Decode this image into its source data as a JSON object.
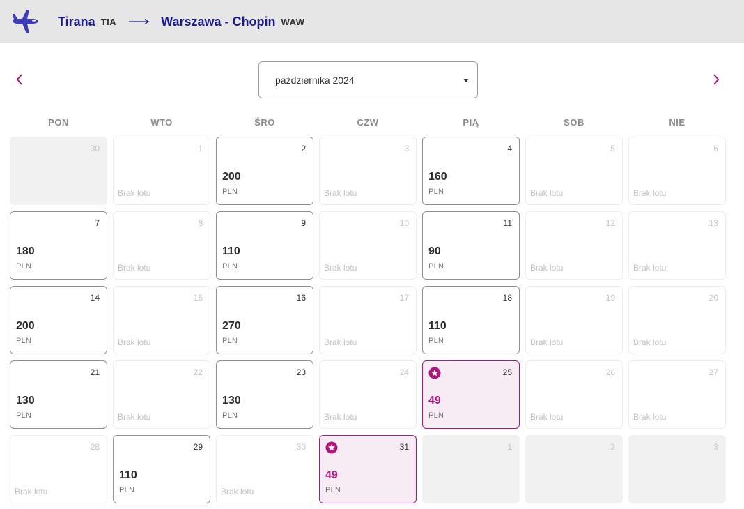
{
  "header": {
    "origin_city": "Tirana",
    "origin_code": "TIA",
    "destination_city": "Warszawa - Chopin",
    "destination_code": "WAW"
  },
  "month_select": {
    "value": "października 2024"
  },
  "weekdays": [
    "PON",
    "WTO",
    "ŚRO",
    "CZW",
    "PIĄ",
    "SOB",
    "NIE"
  ],
  "no_flight_label": "Brak lotu",
  "colors": {
    "brand": "#b0177e",
    "header_bg": "#e6e6e6",
    "plane": "#3b3bb8"
  },
  "days": [
    {
      "day": "30",
      "state": "outside"
    },
    {
      "day": "1",
      "state": "none"
    },
    {
      "day": "2",
      "state": "price",
      "amount": "200",
      "currency": "PLN"
    },
    {
      "day": "3",
      "state": "none"
    },
    {
      "day": "4",
      "state": "price",
      "amount": "160",
      "currency": "PLN"
    },
    {
      "day": "5",
      "state": "none"
    },
    {
      "day": "6",
      "state": "none"
    },
    {
      "day": "7",
      "state": "price",
      "amount": "180",
      "currency": "PLN"
    },
    {
      "day": "8",
      "state": "none"
    },
    {
      "day": "9",
      "state": "price",
      "amount": "110",
      "currency": "PLN"
    },
    {
      "day": "10",
      "state": "none"
    },
    {
      "day": "11",
      "state": "price",
      "amount": "90",
      "currency": "PLN"
    },
    {
      "day": "12",
      "state": "none"
    },
    {
      "day": "13",
      "state": "none"
    },
    {
      "day": "14",
      "state": "price",
      "amount": "200",
      "currency": "PLN"
    },
    {
      "day": "15",
      "state": "none"
    },
    {
      "day": "16",
      "state": "price",
      "amount": "270",
      "currency": "PLN"
    },
    {
      "day": "17",
      "state": "none"
    },
    {
      "day": "18",
      "state": "price",
      "amount": "110",
      "currency": "PLN"
    },
    {
      "day": "19",
      "state": "none"
    },
    {
      "day": "20",
      "state": "none"
    },
    {
      "day": "21",
      "state": "price",
      "amount": "130",
      "currency": "PLN"
    },
    {
      "day": "22",
      "state": "none"
    },
    {
      "day": "23",
      "state": "price",
      "amount": "130",
      "currency": "PLN"
    },
    {
      "day": "24",
      "state": "none"
    },
    {
      "day": "25",
      "state": "promo",
      "amount": "49",
      "currency": "PLN"
    },
    {
      "day": "26",
      "state": "none"
    },
    {
      "day": "27",
      "state": "none"
    },
    {
      "day": "28",
      "state": "none"
    },
    {
      "day": "29",
      "state": "price",
      "amount": "110",
      "currency": "PLN"
    },
    {
      "day": "30",
      "state": "none"
    },
    {
      "day": "31",
      "state": "promo",
      "amount": "49",
      "currency": "PLN"
    },
    {
      "day": "1",
      "state": "outside"
    },
    {
      "day": "2",
      "state": "outside"
    },
    {
      "day": "3",
      "state": "outside"
    }
  ]
}
